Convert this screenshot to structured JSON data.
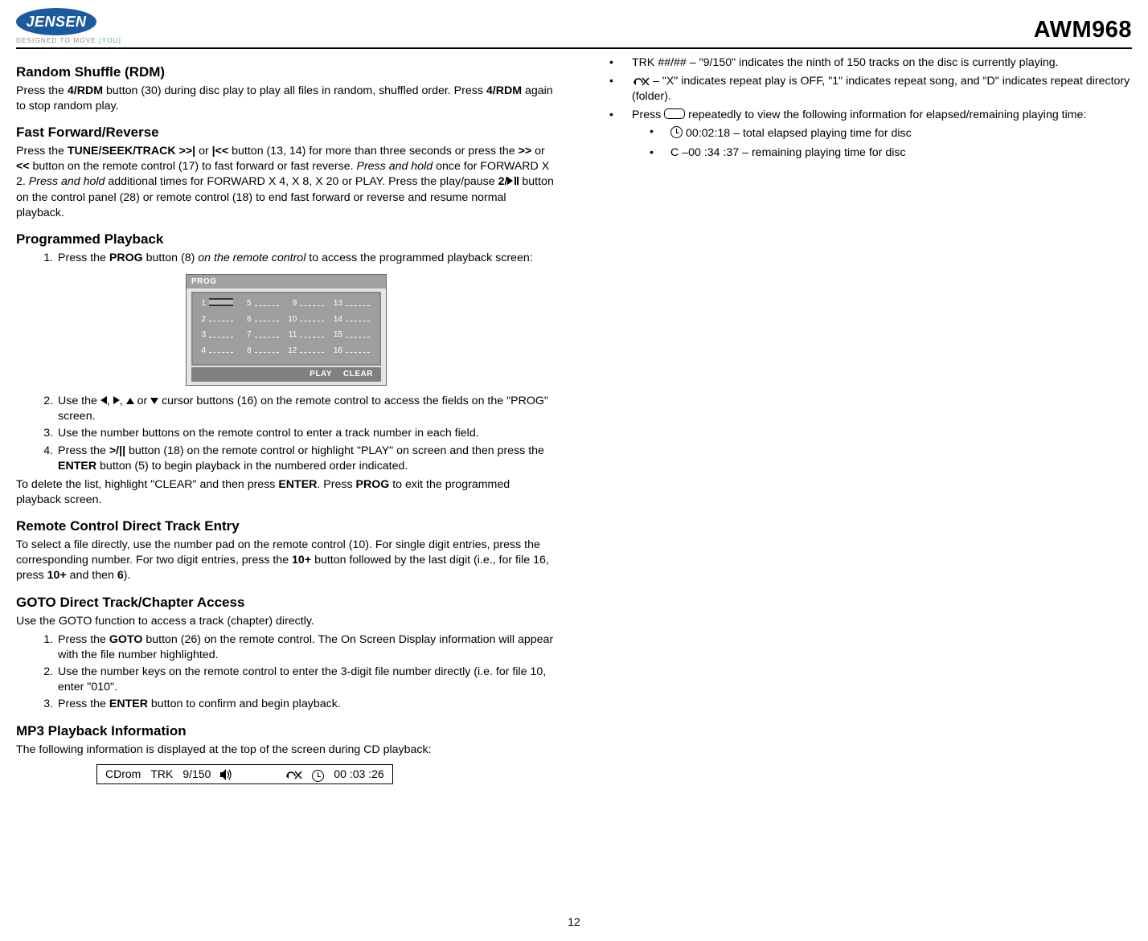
{
  "header": {
    "brand": "JENSEN",
    "tagline": "DESIGNED TO MOVE ",
    "tagline_bracket": "[YOU]",
    "model": "AWM968"
  },
  "page_number": "12",
  "left": {
    "rdm": {
      "heading": "Random Shuffle (RDM)",
      "p_1a": "Press the ",
      "p_1b": "4/RDM",
      "p_1c": " button (30) during disc play to play all files in random, shuffled order. Press ",
      "p_1d": "4/RDM",
      "p_1e": " again to stop random play."
    },
    "ff": {
      "heading": "Fast Forward/Reverse",
      "p_a": "Press the ",
      "p_b": "TUNE/SEEK/TRACK >>|",
      "p_c": " or ",
      "p_d": "|<<",
      "p_e": " button (13, 14) for more than three seconds or press the ",
      "p_f": ">>",
      "p_g": " or ",
      "p_h": "<<",
      "p_i": " button on the remote control (17) to fast forward or fast reverse. ",
      "p_j": "Press and hold",
      "p_k": " once for FORWARD X 2. ",
      "p_l": "Press and hold",
      "p_m": " additional times for FORWARD X 4, X 8, X 20 or PLAY. Press the play/pause ",
      "p_n": "2/",
      "p_o": " button on the control panel (28) or remote control (18) to end fast forward or reverse and resume normal playback."
    },
    "prog": {
      "heading": "Programmed Playback",
      "li1_a": "Press the ",
      "li1_b": "PROG",
      "li1_c": " button (8) ",
      "li1_d": "on the remote control",
      "li1_e": " to access the programmed playback screen:",
      "screen_title": "PROG",
      "screen_play": "PLAY",
      "screen_clear": "CLEAR",
      "li2_a": "Use the ",
      "li2_b": " cursor buttons (16) on the remote control to access the fields on the \"PROG\" screen.",
      "li3": "Use the number buttons on the remote control to enter a track number in each field.",
      "li4_a": "Press the ",
      "li4_b": ">/||",
      "li4_c": " button (18) on the remote control or highlight \"PLAY\" on screen and then press the ",
      "li4_d": "ENTER",
      "li4_e": " button (5) to begin playback in the numbered order indicated.",
      "p2_a": "To delete the list, highlight \"CLEAR\" and then press ",
      "p2_b": "ENTER",
      "p2_c": ". Press ",
      "p2_d": "PROG",
      "p2_e": " to exit the programmed playback screen."
    },
    "direct": {
      "heading": "Remote Control Direct Track Entry",
      "p_a": "To select a file directly, use the number pad on the remote control (10). For single digit entries, press the corresponding number. For two digit entries, press the ",
      "p_b": "10+",
      "p_c": " button followed by the last digit (i.e., for file 16, press ",
      "p_d": "10+",
      "p_e": " and then ",
      "p_f": "6",
      "p_g": ")."
    },
    "goto": {
      "heading": "GOTO Direct Track/Chapter Access",
      "p": "Use the GOTO function to access a track (chapter) directly.",
      "li1_a": "Press the ",
      "li1_b": "GOTO",
      "li1_c": " button (26) on the remote control. The On Screen Display information will appear with the file number highlighted.",
      "li2": "Use the number keys on the remote control to enter the 3-digit file number directly (i.e. for file 10, enter \"010\".",
      "li3_a": "Press the ",
      "li3_b": "ENTER",
      "li3_c": " button to confirm and begin playback."
    },
    "mp3": {
      "heading": "MP3 Playback Information",
      "p": "The following information is displayed at the top of the screen during CD playback:",
      "bar_disc": "CDrom",
      "bar_trk_label": "TRK",
      "bar_trk_val": "9/150",
      "bar_time": "00 :03 :26"
    }
  },
  "right": {
    "b1": "TRK ##/## – \"9/150\" indicates the ninth of 150 tracks on the disc is currently playing.",
    "b2": " – \"X\" indicates repeat play is OFF, \"1\" indicates repeat song, and \"D\" indicates repeat directory (folder).",
    "b3_a": "Press ",
    "b3_b": " repeatedly to view the following information for elapsed/remaining playing time:",
    "b3_sub1": " 00:02:18 – total elapsed playing time for disc",
    "b3_sub2": "C –00 :34 :37 – remaining playing time for disc"
  },
  "prog_grid": {
    "c1": [
      "1",
      "2",
      "3",
      "4"
    ],
    "c2": [
      "5",
      "6",
      "7",
      "8"
    ],
    "c3": [
      "9",
      "10",
      "11",
      "12"
    ],
    "c4": [
      "13",
      "14",
      "15",
      "16"
    ]
  }
}
